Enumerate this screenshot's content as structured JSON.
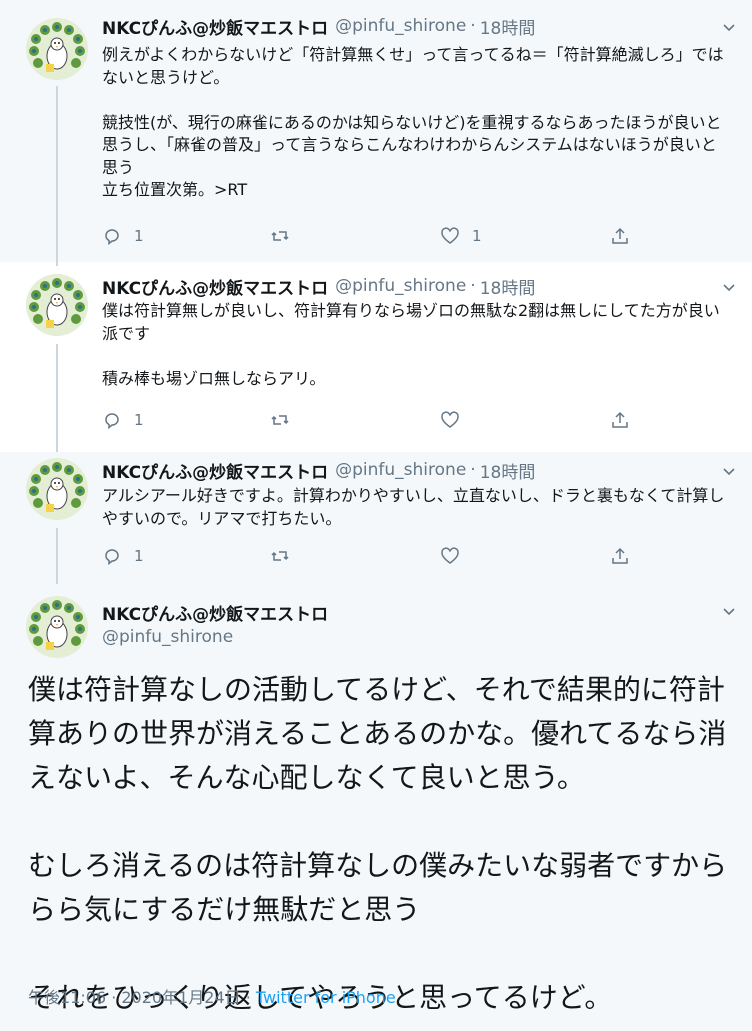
{
  "tweets": [
    {
      "author_name": "NKCぴんふ@炒飯マエストロ",
      "handle": "@pinfu_shirone",
      "separator": "·",
      "time": "18時間",
      "paragraphs": [
        "例えがよくわからないけど「符計算無くせ」って言ってるね＝「符計算絶滅しろ」ではないと思うけど。",
        "",
        "競技性(が、現行の麻雀にあるのかは知らないけど)を重視するならあったほうが良いと思うし、「麻雀の普及」って言うならこんなわけわからんシステムはないほうが良いと思う",
        "立ち位置次第。>RT"
      ],
      "reply_count": "1",
      "retweet_count": "",
      "like_count": "1"
    },
    {
      "author_name": "NKCぴんふ@炒飯マエストロ",
      "handle": "@pinfu_shirone",
      "separator": "·",
      "time": "18時間",
      "paragraphs": [
        "僕は符計算無しが良いし、符計算有りなら場ゾロの無駄な2翻は無しにしてた方が良い派です",
        "",
        "積み棒も場ゾロ無しならアリ。"
      ],
      "reply_count": "1",
      "retweet_count": "",
      "like_count": ""
    },
    {
      "author_name": "NKCぴんふ@炒飯マエストロ",
      "handle": "@pinfu_shirone",
      "separator": "·",
      "time": "18時間",
      "paragraphs": [
        "アルシアール好きですよ。計算わかりやすいし、立直ないし、ドラと裏もなくて計算しやすいので。リアマで打ちたい。"
      ],
      "reply_count": "1",
      "retweet_count": "",
      "like_count": ""
    }
  ],
  "main_tweet": {
    "author_name": "NKCぴんふ@炒飯マエストロ",
    "handle": "@pinfu_shirone",
    "paragraphs": [
      "僕は符計算なしの活動してるけど、それで結果的に符計算ありの世界が消えることあるのかな。優れてるなら消えないよ、そんな心配しなくて良いと思う。",
      "",
      "むしろ消えるのは符計算なしの僕みたいな弱者ですかららら気にするだけ無駄だと思う",
      "",
      "それをひっくり返してやろうと思ってるけど。"
    ],
    "timestamp": "午後11:06 · 2020年1月24日 · ",
    "source": "Twitter for iPhone"
  },
  "icons": {
    "reply": "reply-icon",
    "retweet": "retweet-icon",
    "like": "heart-icon",
    "share": "share-icon",
    "caret": "chevron-down-icon",
    "avatar": "peacock-avatar"
  },
  "colors": {
    "background": "#f5f8fa",
    "text": "#14171a",
    "secondary": "#657786",
    "link": "#1da1f2"
  }
}
